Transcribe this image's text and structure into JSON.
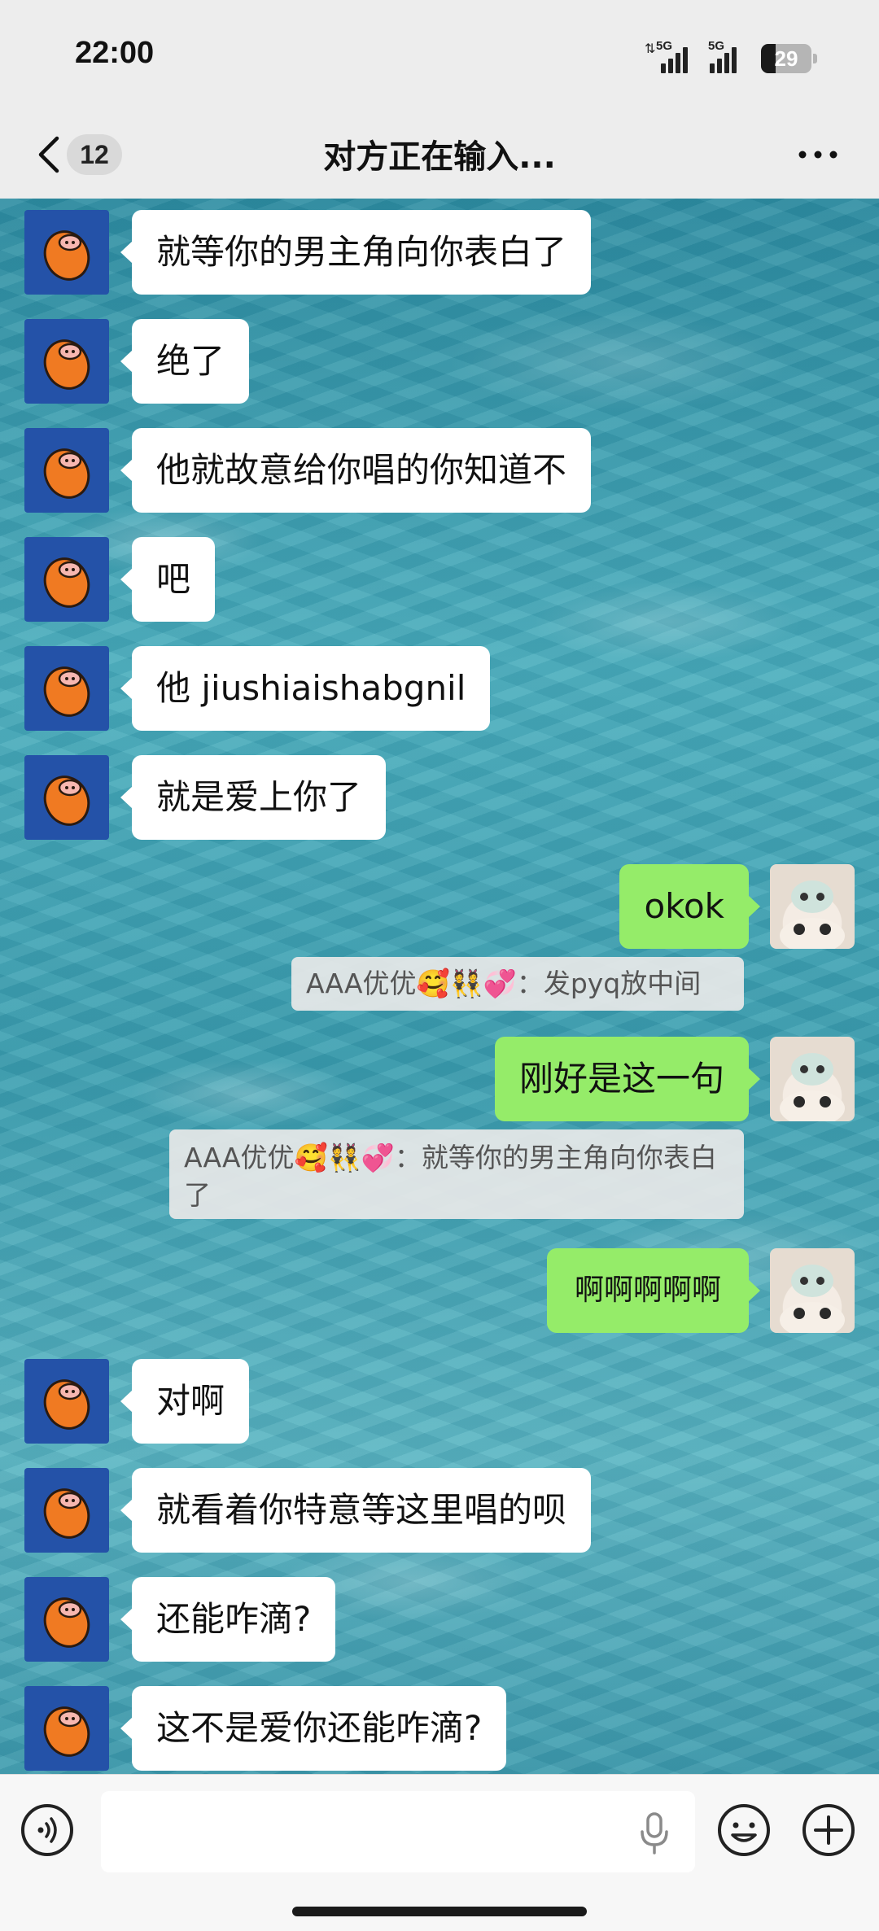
{
  "status_bar": {
    "time": "22:00",
    "signal1_label": "5G",
    "signal2_label": "5G",
    "battery_level": "29",
    "battery_fraction": 0.29
  },
  "nav": {
    "unread_count": "12",
    "title": "对方正在输入..."
  },
  "messages": [
    {
      "side": "left",
      "text": "就等你的男主角向你表白了"
    },
    {
      "side": "left",
      "text": "绝了"
    },
    {
      "side": "left",
      "text": "他就故意给你唱的你知道不"
    },
    {
      "side": "left",
      "text": "吧"
    },
    {
      "side": "left",
      "text": "他 jiushiaishabgnil"
    },
    {
      "side": "left",
      "text": "就是爱上你了"
    },
    {
      "side": "right",
      "text": "okok"
    },
    {
      "side": "quote",
      "text": "AAA优优🥰👯💞：发pyq放中间"
    },
    {
      "side": "right",
      "text": "刚好是这一句"
    },
    {
      "side": "quote",
      "text": "AAA优优🥰👯💞：就等你的男主角向你表白了"
    },
    {
      "side": "right",
      "text": "啊啊啊啊啊"
    },
    {
      "side": "left",
      "text": "对啊"
    },
    {
      "side": "left",
      "text": "就看着你特意等这里唱的呗"
    },
    {
      "side": "left",
      "text": "还能咋滴?"
    },
    {
      "side": "left",
      "text": "这不是爱你还能咋滴?"
    }
  ],
  "icons": {
    "back": "chevron-left-icon",
    "more": "more-horizontal-icon",
    "voice": "voice-icon",
    "mic": "mic-icon",
    "emoji": "emoji-icon",
    "add": "plus-icon"
  },
  "colors": {
    "self_bubble": "#95ec69",
    "other_bubble": "#ffffff",
    "left_avatar_bg": "#2452a8"
  }
}
